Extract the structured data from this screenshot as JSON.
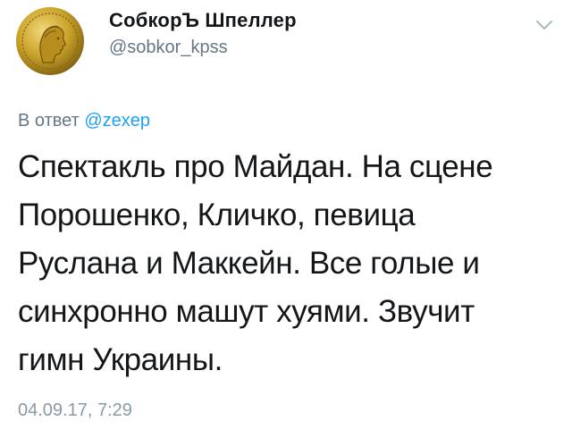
{
  "tweet": {
    "author": {
      "display_name": "СобкорЪ Шпеллер",
      "handle": "@sobkor_kpss",
      "avatar_icon": "gold-coin-avatar"
    },
    "menu_icon": "chevron-down-icon",
    "reply_to": {
      "prefix": "В ответ",
      "mention": "@zexep"
    },
    "text_lines": [
      "Спектакль про Майдан. На сцене",
      "Порошенко, Кличко, певица",
      "Руслана и Маккейн. Все голые и",
      "синхронно машут хуями. Звучит",
      "гимн Украины."
    ],
    "timestamp": "04.09.17, 7:29"
  },
  "colors": {
    "text": "#14171a",
    "secondary": "#657786",
    "link": "#1da1f2",
    "timestamp": "#8899a6",
    "coin_gold": "#c9a227"
  }
}
